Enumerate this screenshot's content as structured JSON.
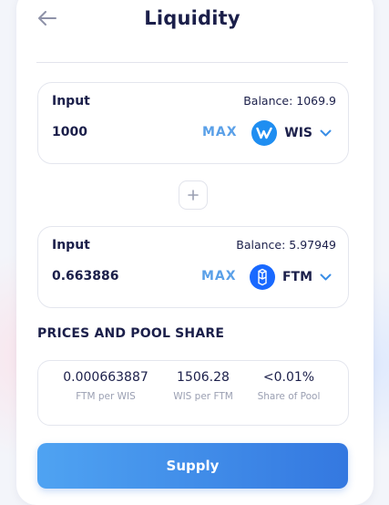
{
  "header": {
    "title": "Liquidity",
    "back_icon": "arrow-left-icon"
  },
  "input_a": {
    "label": "Input",
    "balance": "Balance: 1069.9",
    "amount": "1000",
    "max_label": "MAX",
    "token": {
      "symbol": "WIS",
      "icon": "wis-token-icon",
      "color": "#1f8ef1"
    }
  },
  "plus_icon": "plus-icon",
  "input_b": {
    "label": "Input",
    "balance": "Balance: 5.97949",
    "amount": "0.663886",
    "max_label": "MAX",
    "token": {
      "symbol": "FTM",
      "icon": "ftm-token-icon",
      "color": "#1969ff"
    }
  },
  "prices": {
    "heading": "PRICES AND POOL SHARE",
    "items": [
      {
        "value": "0.000663887",
        "label": "FTM per WIS"
      },
      {
        "value": "1506.28",
        "label": "WIS per FTM"
      },
      {
        "value": "<0.01%",
        "label": "Share of Pool"
      }
    ]
  },
  "supply_label": "Supply",
  "colors": {
    "accent": "#5aa0e8",
    "button_start": "#4fa3f2",
    "button_end": "#3478e0",
    "text": "#1b1f4a",
    "muted": "#9a9fb2"
  }
}
